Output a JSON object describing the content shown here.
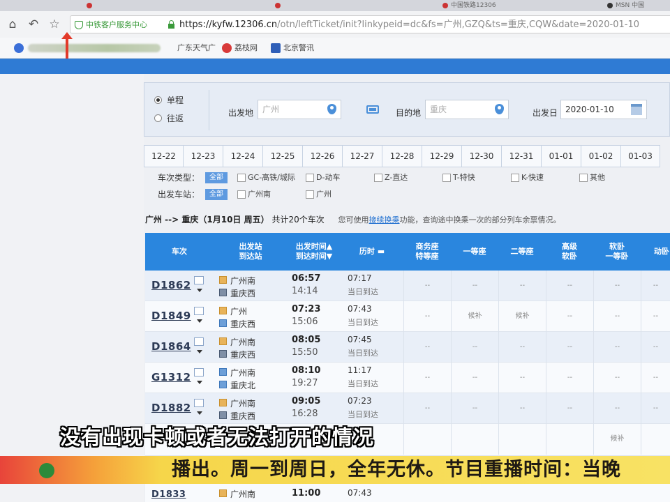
{
  "browser": {
    "tabs": [
      "",
      "",
      "",
      "中国铁路12306",
      "MSN 中国"
    ],
    "ev_label": "中铁客户服务中心",
    "url_host": "https://kyfw.12306.cn",
    "url_path": "/otn/leftTicket/init?linkypeid=dc&fs=广州,GZQ&ts=重庆,CQW&date=2020-01-10",
    "bookmarks": [
      "广东天气广",
      "荔枝网",
      "北京警讯"
    ]
  },
  "search": {
    "trip_types": [
      "单程",
      "往返"
    ],
    "selected_trip": "单程",
    "from_label": "出发地",
    "from_value": "广州",
    "to_label": "目的地",
    "to_value": "重庆",
    "date_label": "出发日",
    "date_value": "2020-01-10"
  },
  "dates": [
    "12-22",
    "12-23",
    "12-24",
    "12-25",
    "12-26",
    "12-27",
    "12-28",
    "12-29",
    "12-30",
    "12-31",
    "01-01",
    "01-02",
    "01-03"
  ],
  "filters": {
    "type_label": "车次类型：",
    "all_label": "全部",
    "types": [
      "GC-高铁/城际",
      "D-动车",
      "Z-直达",
      "T-特快",
      "K-快速",
      "其他"
    ],
    "station_label": "出发车站：",
    "stations": [
      "广州南",
      "广州"
    ]
  },
  "result": {
    "route": "广州 --> 重庆（1月10日 周五）",
    "count": "共计20个车次",
    "tip_prefix": "您可使用",
    "tip_link": "接续换乘",
    "tip_suffix": "功能，查询途中换乘一次的部分列车余票情况。"
  },
  "table": {
    "headers": [
      {
        "l1": "车次",
        "l2": ""
      },
      {
        "l1": "出发站",
        "l2": "到达站"
      },
      {
        "l1": "出发时间▲",
        "l2": "到达时间▼"
      },
      {
        "l1": "历时 ▬",
        "l2": ""
      },
      {
        "l1": "商务座",
        "l2": "特等座"
      },
      {
        "l1": "一等座",
        "l2": ""
      },
      {
        "l1": "二等座",
        "l2": ""
      },
      {
        "l1": "高级",
        "l2": "软卧"
      },
      {
        "l1": "软卧",
        "l2": "一等卧"
      },
      {
        "l1": "动卧",
        "l2": ""
      }
    ],
    "rows": [
      {
        "train": "D1862",
        "from": "广州南",
        "to": "重庆西",
        "dep": "06:57",
        "arr": "14:14",
        "dur": "07:17",
        "arrive_day": "当日到达",
        "seats": [
          "--",
          "--",
          "--",
          "--",
          "--",
          "--"
        ]
      },
      {
        "train": "D1849",
        "from": "广州",
        "to": "重庆西",
        "dep": "07:23",
        "arr": "15:06",
        "dur": "07:43",
        "arrive_day": "当日到达",
        "seats": [
          "--",
          "候补",
          "候补",
          "--",
          "--",
          "--"
        ]
      },
      {
        "train": "D1864",
        "from": "广州南",
        "to": "重庆西",
        "dep": "08:05",
        "arr": "15:50",
        "dur": "07:45",
        "arrive_day": "当日到达",
        "seats": [
          "--",
          "--",
          "--",
          "--",
          "--",
          "--"
        ]
      },
      {
        "train": "G1312",
        "from": "广州南",
        "to": "重庆北",
        "dep": "08:10",
        "arr": "19:27",
        "dur": "11:17",
        "arrive_day": "当日到达",
        "seats": [
          "--",
          "--",
          "--",
          "--",
          "--",
          "--"
        ]
      },
      {
        "train": "D1882",
        "from": "广州南",
        "to": "重庆西",
        "dep": "09:05",
        "arr": "16:28",
        "dur": "07:23",
        "arrive_day": "当日到达",
        "seats": [
          "--",
          "--",
          "--",
          "--",
          "--",
          "--"
        ]
      },
      {
        "train": "",
        "from": "",
        "to": "",
        "dep": "",
        "arr": "",
        "dur": "",
        "arrive_day": "",
        "seats": [
          "",
          "",
          "",
          "",
          "候补",
          ""
        ]
      }
    ],
    "partial_row": {
      "train": "D1833",
      "from": "广州南",
      "dep": "11:00",
      "dur": "07:43"
    }
  },
  "subtitle": "没有出现卡顿或者无法打开的情况",
  "ticker": "播出。周一到周日，全年无休。节目重播时间：当晚",
  "colors": {
    "accent": "#2a86de",
    "row_alt": "#e9eff8",
    "ticker": "#f6d64a"
  }
}
